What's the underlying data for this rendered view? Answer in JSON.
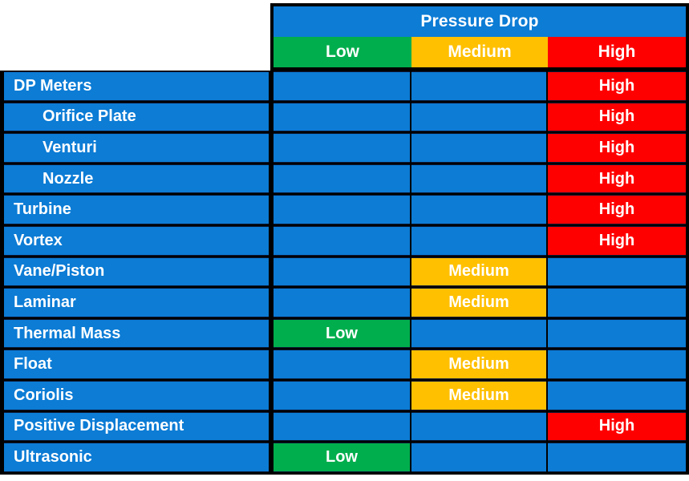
{
  "table": {
    "title_column_header": "",
    "group_header": "Pressure Drop",
    "columns": [
      {
        "key": "low",
        "label": "Low",
        "color": "#00AE4D"
      },
      {
        "key": "medium",
        "label": "Medium",
        "color": "#FFC000"
      },
      {
        "key": "high",
        "label": "High",
        "color": "#FF0000"
      }
    ],
    "palette": {
      "blue": "#0C7CD5",
      "green": "#00AE4D",
      "yellow": "#FFC000",
      "red": "#FF0000",
      "border": "#000000",
      "text": "#FFFFFF"
    },
    "rows": [
      {
        "name": "DP Meters",
        "indent": false,
        "low": "",
        "medium": "",
        "high": "High"
      },
      {
        "name": "Orifice Plate",
        "indent": true,
        "low": "",
        "medium": "",
        "high": "High"
      },
      {
        "name": "Venturi",
        "indent": true,
        "low": "",
        "medium": "",
        "high": "High"
      },
      {
        "name": "Nozzle",
        "indent": true,
        "low": "",
        "medium": "",
        "high": "High"
      },
      {
        "name": "Turbine",
        "indent": false,
        "low": "",
        "medium": "",
        "high": "High"
      },
      {
        "name": "Vortex",
        "indent": false,
        "low": "",
        "medium": "",
        "high": "High"
      },
      {
        "name": "Vane/Piston",
        "indent": false,
        "low": "",
        "medium": "Medium",
        "high": ""
      },
      {
        "name": "Laminar",
        "indent": false,
        "low": "",
        "medium": "Medium",
        "high": ""
      },
      {
        "name": "Thermal Mass",
        "indent": false,
        "low": "Low",
        "medium": "",
        "high": ""
      },
      {
        "name": "Float",
        "indent": false,
        "low": "",
        "medium": "Medium",
        "high": ""
      },
      {
        "name": "Coriolis",
        "indent": false,
        "low": "",
        "medium": "Medium",
        "high": ""
      },
      {
        "name": "Positive Displacement",
        "indent": false,
        "low": "",
        "medium": "",
        "high": "High"
      },
      {
        "name": "Ultrasonic",
        "indent": false,
        "low": "Low",
        "medium": "",
        "high": ""
      }
    ]
  },
  "chart_data": {
    "type": "heatmap",
    "title": "Pressure Drop",
    "xlabel": "Pressure Drop",
    "ylabel": "",
    "categories": [
      "Low",
      "Medium",
      "High"
    ],
    "legend": [
      {
        "label": "Low",
        "color": "#00AE4D"
      },
      {
        "label": "Medium",
        "color": "#FFC000"
      },
      {
        "label": "High",
        "color": "#FF0000"
      }
    ],
    "rows": [
      "DP Meters",
      "Orifice Plate",
      "Venturi",
      "Nozzle",
      "Turbine",
      "Vortex",
      "Vane/Piston",
      "Laminar",
      "Thermal Mass",
      "Float",
      "Coriolis",
      "Positive Displacement",
      "Ultrasonic"
    ],
    "values": [
      [
        "",
        "",
        "High"
      ],
      [
        "",
        "",
        "High"
      ],
      [
        "",
        "",
        "High"
      ],
      [
        "",
        "",
        "High"
      ],
      [
        "",
        "",
        "High"
      ],
      [
        "",
        "",
        "High"
      ],
      [
        "",
        "Medium",
        ""
      ],
      [
        "",
        "Medium",
        ""
      ],
      [
        "Low",
        "",
        ""
      ],
      [
        "",
        "Medium",
        ""
      ],
      [
        "",
        "Medium",
        ""
      ],
      [
        "",
        "",
        "High"
      ],
      [
        "Low",
        "",
        ""
      ]
    ]
  }
}
